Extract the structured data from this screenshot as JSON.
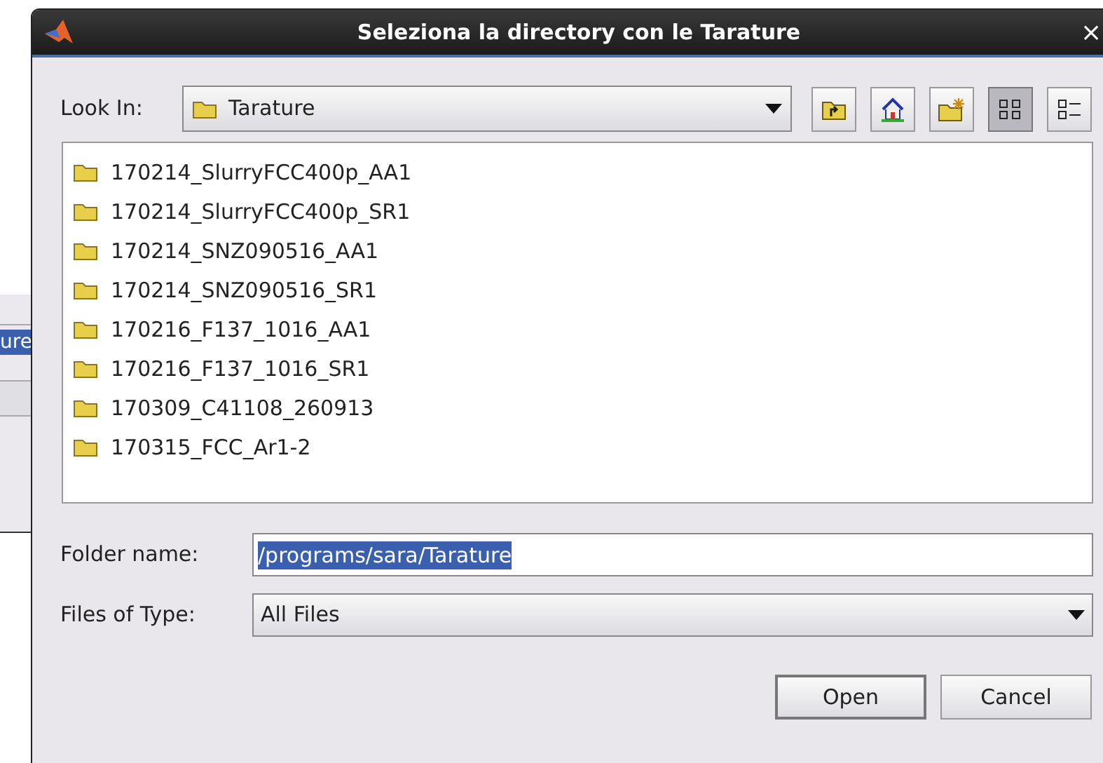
{
  "background_window": {
    "field_text": "ure"
  },
  "dialog": {
    "title": "Seleziona la directory con le Tarature",
    "close": "×"
  },
  "look_in": {
    "label": "Look In:",
    "value": "Tarature"
  },
  "toolbar": [
    {
      "kind": "up",
      "selected": false
    },
    {
      "kind": "home",
      "selected": false
    },
    {
      "kind": "newfolder",
      "selected": false
    },
    {
      "kind": "list",
      "selected": true
    },
    {
      "kind": "details",
      "selected": false
    }
  ],
  "files": [
    {
      "name": "170214_SlurryFCC400p_AA1"
    },
    {
      "name": "170214_SlurryFCC400p_SR1"
    },
    {
      "name": "170214_SNZ090516_AA1"
    },
    {
      "name": "170214_SNZ090516_SR1"
    },
    {
      "name": "170216_F137_1016_AA1"
    },
    {
      "name": "170216_F137_1016_SR1"
    },
    {
      "name": "170309_C41108_260913"
    },
    {
      "name": "170315_FCC_Ar1-2"
    }
  ],
  "folder_name": {
    "label": "Folder name:",
    "value": "/programs/sara/Tarature"
  },
  "files_of_type": {
    "label": "Files of Type:",
    "value": "All Files"
  },
  "buttons": [
    "Open",
    "Cancel"
  ]
}
